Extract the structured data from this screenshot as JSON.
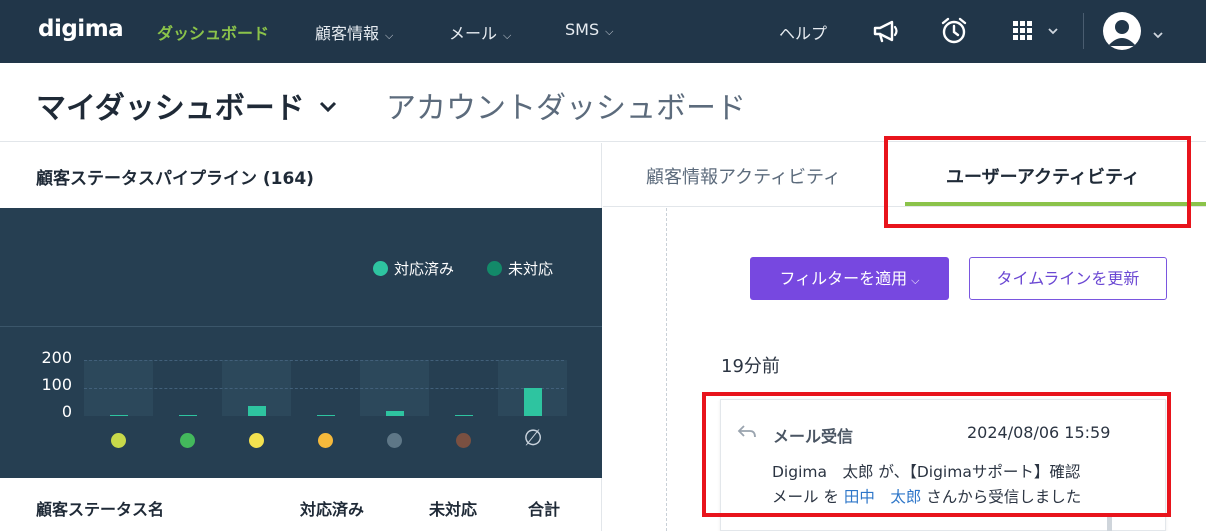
{
  "nav": {
    "logo_main": "digima",
    "items": [
      {
        "label": "ダッシュボード",
        "active": true
      },
      {
        "label": "顧客情報",
        "dropdown": true
      },
      {
        "label": "メール",
        "dropdown": true
      },
      {
        "label": "SMS",
        "dropdown": true
      }
    ],
    "help_label": "ヘルプ",
    "icons": [
      "megaphone-icon",
      "alarm-clock-icon",
      "apps-grid-icon",
      "user-avatar-icon"
    ]
  },
  "header": {
    "title": "マイダッシュボード",
    "alt_title": "アカウントダッシュボード"
  },
  "pipeline": {
    "title": "顧客ステータスパイプライン (164)",
    "legend": [
      {
        "label": "対応済み",
        "color": "#2ec4a0"
      },
      {
        "label": "未対応",
        "color": "#138a69"
      }
    ],
    "table_headers": [
      "顧客ステータス名",
      "対応済み",
      "未対応",
      "合計"
    ]
  },
  "chart_data": {
    "type": "bar",
    "y_ticks": [
      "200",
      "100",
      "0"
    ],
    "ylim": [
      0,
      200
    ],
    "categories": [
      "#c8d94a",
      "#43b85c",
      "#f3e14f",
      "#f5b93b",
      "#5e7787",
      "#7a5041",
      "∅"
    ],
    "series": [
      {
        "name": "対応済み",
        "values": [
          1,
          2,
          37,
          2,
          18,
          2,
          100
        ]
      }
    ]
  },
  "activity": {
    "tabs": [
      {
        "label": "顧客情報アクティビティ",
        "active": false
      },
      {
        "label": "ユーザーアクティビティ",
        "active": true
      }
    ],
    "filter_button": "フィルターを適用",
    "refresh_button": "タイムラインを更新",
    "time_ago": "19分前",
    "card": {
      "title": "メール受信",
      "timestamp": "2024/08/06 15:59",
      "line1": "Digima　太郎 が、【Digimaサポート】確認",
      "line2_prefix": "メール を ",
      "line2_link": "田中　太郎",
      "line2_suffix": " さんから受信しました"
    }
  },
  "colors": {
    "nav_bg": "#213649",
    "accent_green": "#8bc34a",
    "chart_bg": "#263f52",
    "primary_purple": "#7748e0",
    "highlight_red": "#e8141c",
    "link_blue": "#2f77c9"
  }
}
